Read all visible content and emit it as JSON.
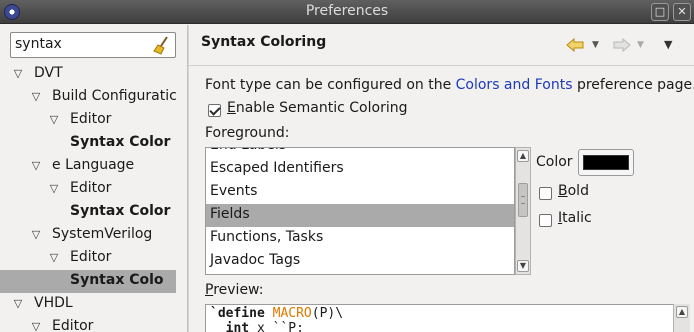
{
  "window": {
    "title": "Preferences"
  },
  "filter": {
    "value": "syntax"
  },
  "tree": [
    {
      "label": "DVT",
      "arrow": "▽",
      "bold": false,
      "selected": false
    },
    {
      "label": "Build Configuratic",
      "arrow": "▽",
      "bold": false,
      "selected": false
    },
    {
      "label": "Editor",
      "arrow": "▽",
      "bold": false,
      "selected": false
    },
    {
      "label": "Syntax Color",
      "arrow": "",
      "bold": true,
      "selected": false
    },
    {
      "label": "e Language",
      "arrow": "▽",
      "bold": false,
      "selected": false
    },
    {
      "label": "Editor",
      "arrow": "▽",
      "bold": false,
      "selected": false
    },
    {
      "label": "Syntax Color",
      "arrow": "",
      "bold": true,
      "selected": false
    },
    {
      "label": "SystemVerilog",
      "arrow": "▽",
      "bold": false,
      "selected": false
    },
    {
      "label": "Editor",
      "arrow": "▽",
      "bold": false,
      "selected": false
    },
    {
      "label": "Syntax Colo",
      "arrow": "",
      "bold": true,
      "selected": true
    },
    {
      "label": "VHDL",
      "arrow": "▽",
      "bold": false,
      "selected": false
    },
    {
      "label": "Editor",
      "arrow": "▽",
      "bold": false,
      "selected": false
    }
  ],
  "page": {
    "title": "Syntax Coloring",
    "desc_before": "Font type can be configured on the ",
    "desc_link": "Colors and Fonts",
    "desc_after": " preference page.",
    "semantic_first": "E",
    "semantic_rest": "nable Semantic Coloring",
    "foreground_label": "Foreground:",
    "color_label": "Color",
    "bold_first": "B",
    "bold_rest": "old",
    "italic_first": "I",
    "italic_rest": "talic",
    "preview_first": "P",
    "preview_rest": "review:",
    "swatch_color": "#000000"
  },
  "foreground_items": [
    {
      "label": "End Labels",
      "selected": false
    },
    {
      "label": "Escaped Identifiers",
      "selected": false
    },
    {
      "label": "Events",
      "selected": false
    },
    {
      "label": "Fields",
      "selected": true
    },
    {
      "label": "Functions, Tasks",
      "selected": false
    },
    {
      "label": "Javadoc Tags",
      "selected": false
    }
  ],
  "preview": {
    "line1_kw": "`define",
    "line1_macro": "MACRO",
    "line1_rest": "(P)\\",
    "line2_kw": "int",
    "line2_rest": " x ``P;"
  },
  "colors": {
    "accent_link": "#1b3bb8",
    "selection": "#aaaaaa",
    "macro": "#e07800"
  }
}
